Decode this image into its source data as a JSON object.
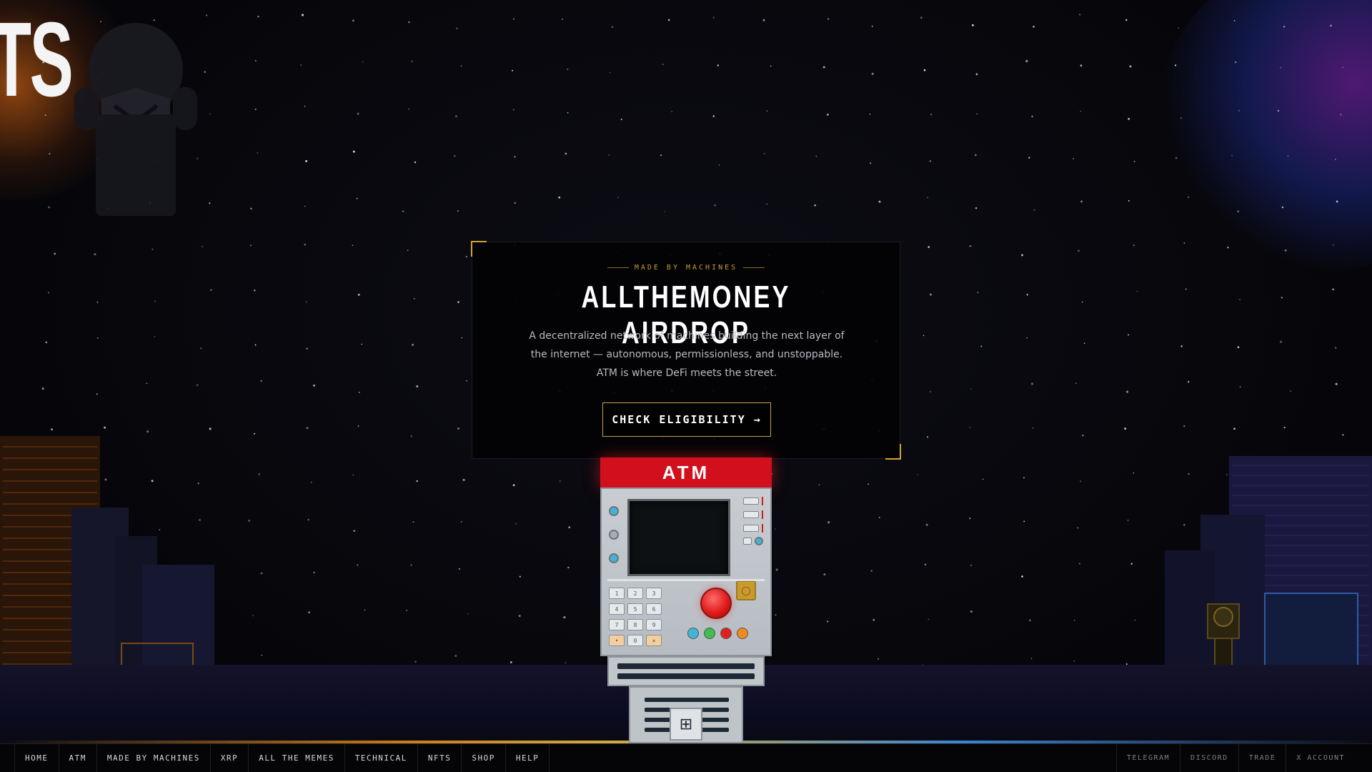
{
  "hero_letters": "TS",
  "panel": {
    "eyebrow": "MADE BY MACHINES",
    "title": "ALLTHEMONEY AIRDROP",
    "description": "A decentralized network of machines building the next layer of the internet — autonomous, permissionless, and unstoppable. ATM is where DeFi meets the street.",
    "cta_label": "CHECK ELIGIBILITY →"
  },
  "atm": {
    "sign": "ATM",
    "keypad": [
      "1",
      "2",
      "3",
      "4",
      "5",
      "6",
      "7",
      "8",
      "9",
      "•",
      "0",
      "×"
    ],
    "button_colors": [
      "#42b4d6",
      "#3fbd4f",
      "#e02020",
      "#f08a1c"
    ],
    "brand_red": "#d20f1c"
  },
  "nav": {
    "left": [
      "HOME",
      "ATM",
      "MADE BY MACHINES",
      "XRP",
      "ALL THE MEMES",
      "TECHNICAL",
      "NFTS",
      "SHOP",
      "HELP"
    ],
    "right": [
      "TELEGRAM",
      "DISCORD",
      "TRADE",
      "X ACCOUNT"
    ]
  },
  "colors": {
    "accent_gold": "#d4a332",
    "background": "#07070c"
  }
}
